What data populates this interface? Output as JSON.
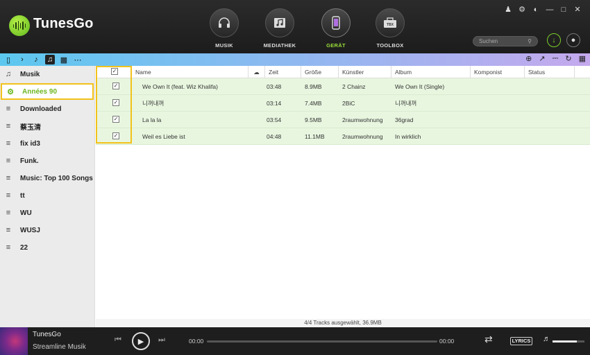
{
  "app": {
    "name": "TunesGo"
  },
  "nav": [
    {
      "label": "MUSIK",
      "icon": "headphones-icon"
    },
    {
      "label": "MEDIATHEK",
      "icon": "music-library-icon"
    },
    {
      "label": "GERÄT",
      "icon": "phone-icon",
      "active": true
    },
    {
      "label": "TOOLBOX",
      "icon": "toolbox-icon",
      "badge": "TBX"
    }
  ],
  "search": {
    "placeholder": "Suchen"
  },
  "sidebar": {
    "items": [
      {
        "label": "Musik",
        "icon": "music-note-icon"
      },
      {
        "label": "Années 90",
        "icon": "gear-icon",
        "selected": true
      },
      {
        "label": "Downloaded",
        "icon": "playlist-icon"
      },
      {
        "label": "蔡玉清",
        "icon": "playlist-icon"
      },
      {
        "label": "fix id3",
        "icon": "playlist-icon"
      },
      {
        "label": "Funk.",
        "icon": "playlist-icon"
      },
      {
        "label": "Music: Top 100 Songs",
        "icon": "playlist-icon"
      },
      {
        "label": "tt",
        "icon": "playlist-icon"
      },
      {
        "label": "WU",
        "icon": "playlist-icon"
      },
      {
        "label": "WUSJ",
        "icon": "playlist-icon"
      },
      {
        "label": "22",
        "icon": "playlist-icon"
      }
    ]
  },
  "table": {
    "columns": [
      "Name",
      "Zeit",
      "Größe",
      "Künstler",
      "Album",
      "Komponist",
      "Status"
    ],
    "rows": [
      {
        "checked": true,
        "name": "We Own It (feat. Wiz Khalifa)",
        "time": "03:48",
        "size": "8.9MB",
        "artist": "2 Chainz",
        "album": "We Own It (Single)",
        "composer": "",
        "status": ""
      },
      {
        "checked": true,
        "name": "니꺼내꺼",
        "time": "03:14",
        "size": "7.4MB",
        "artist": "2BiC",
        "album": "니꺼내꺼",
        "composer": "",
        "status": ""
      },
      {
        "checked": true,
        "name": "La la la",
        "time": "03:54",
        "size": "9.5MB",
        "artist": "2raumwohnung",
        "album": "36grad",
        "composer": "",
        "status": ""
      },
      {
        "checked": true,
        "name": "Weil es Liebe ist",
        "time": "04:48",
        "size": "11.1MB",
        "artist": "2raumwohnung",
        "album": "In wirklich",
        "composer": "",
        "status": ""
      }
    ]
  },
  "status_text": "4/4 Tracks ausgewählt, 36.9MB",
  "player": {
    "title": "TunesGo",
    "subtitle": "Streamline Musik",
    "time_current": "00:00",
    "time_total": "00:00",
    "lyrics_label": "LYRICS",
    "volume": 0.75
  },
  "colors": {
    "accent": "#6cb71e",
    "highlight": "#f2c21b",
    "row_bg": "#e8f6df"
  }
}
